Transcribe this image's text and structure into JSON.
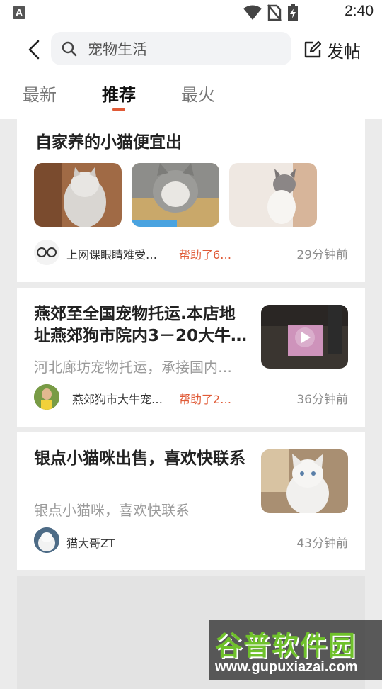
{
  "status_bar": {
    "time": "2:40",
    "app_icon_letter": "A"
  },
  "header": {
    "search_text": "宠物生活",
    "post_label": "发帖"
  },
  "tabs": [
    {
      "label": "最新"
    },
    {
      "label": "推荐"
    },
    {
      "label": "最火"
    }
  ],
  "posts": [
    {
      "title": "自家养的小猫便宜出",
      "author": "上网课眼睛难受…",
      "helped": "帮助了6…",
      "time": "29分钟前"
    },
    {
      "title": "燕郊至全国宠物托运.本店地址燕郊狗市院内3－20大牛…",
      "summary": "河北廊坊宠物托运，承接国内…",
      "author": "燕郊狗市大牛宠…",
      "helped": "帮助了2…",
      "time": "36分钟前"
    },
    {
      "title": "银点小猫咪出售，喜欢快联系",
      "summary": "银点小猫咪，喜欢快联系",
      "author": "猫大哥ZT",
      "time": "43分钟前"
    }
  ],
  "watermark": {
    "text": "谷普软件园",
    "url": "www.gupuxiazai.com"
  },
  "colors": {
    "accent": "#e05a36",
    "background": "#ebebeb"
  }
}
